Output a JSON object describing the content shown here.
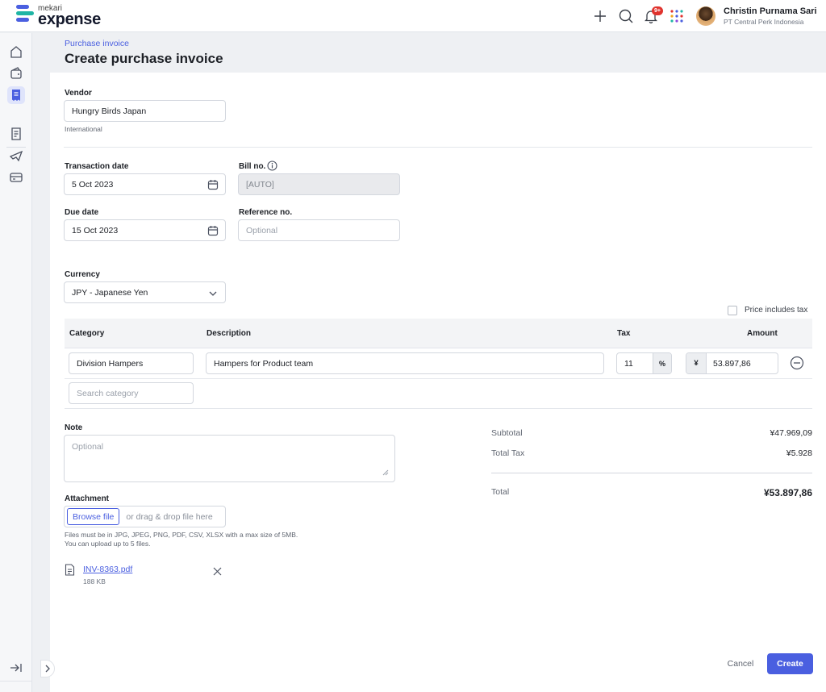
{
  "app": {
    "logo_small": "mekari",
    "logo_big": "expense",
    "notification_badge": "9+",
    "accent_color": "#4a5fe0",
    "icons": [
      "plus-icon",
      "search-icon",
      "bell-icon",
      "apps-grid-icon"
    ]
  },
  "user": {
    "name": "Christin Purnama Sari",
    "company": "PT Central Perk Indonesia"
  },
  "sidebar": {
    "items": [
      "home-icon",
      "wallet-icon",
      "invoice-icon",
      "report-icon",
      "travel-icon",
      "card-icon"
    ],
    "active": "invoice-icon"
  },
  "header": {
    "breadcrumb": "Purchase invoice",
    "title": "Create purchase invoice"
  },
  "form": {
    "vendor_label": "Vendor",
    "vendor_value": "Hungry Birds Japan",
    "vendor_hint": "International",
    "transaction_date_label": "Transaction date",
    "transaction_date_value": "5 Oct 2023",
    "bill_no_label": "Bill no.",
    "bill_no_value": "[AUTO]",
    "due_date_label": "Due date",
    "due_date_value": "15 Oct 2023",
    "reference_label": "Reference no.",
    "reference_placeholder": "Optional",
    "currency_label": "Currency",
    "currency_value": "JPY - Japanese Yen",
    "price_includes_tax_label": "Price includes tax",
    "price_includes_tax_checked": false
  },
  "table": {
    "headers": {
      "category": "Category",
      "description": "Description",
      "tax": "Tax",
      "amount": "Amount"
    },
    "rows": [
      {
        "category": "Division Hampers",
        "description": "Hampers for Product team",
        "tax": "11",
        "tax_suffix": "%",
        "currency_symbol": "¥",
        "amount": "53.897,86"
      }
    ],
    "search_category_placeholder": "Search category"
  },
  "note": {
    "label": "Note",
    "placeholder": "Optional"
  },
  "summary": {
    "subtotal_label": "Subtotal",
    "subtotal_value": "¥47.969,09",
    "total_tax_label": "Total Tax",
    "total_tax_value": "¥5.928",
    "total_label": "Total",
    "total_value": "¥53.897,86"
  },
  "attachment": {
    "label": "Attachment",
    "browse_label": "Browse file",
    "drop_text": "or drag & drop file here",
    "hint_line1": "Files must be in JPG, JPEG, PNG, PDF, CSV, XLSX with a max size of 5MB.",
    "hint_line2": "You can upload up to 5 files.",
    "file_name": "INV-8363.pdf",
    "file_size": "188 KB"
  },
  "actions": {
    "cancel": "Cancel",
    "create": "Create"
  }
}
